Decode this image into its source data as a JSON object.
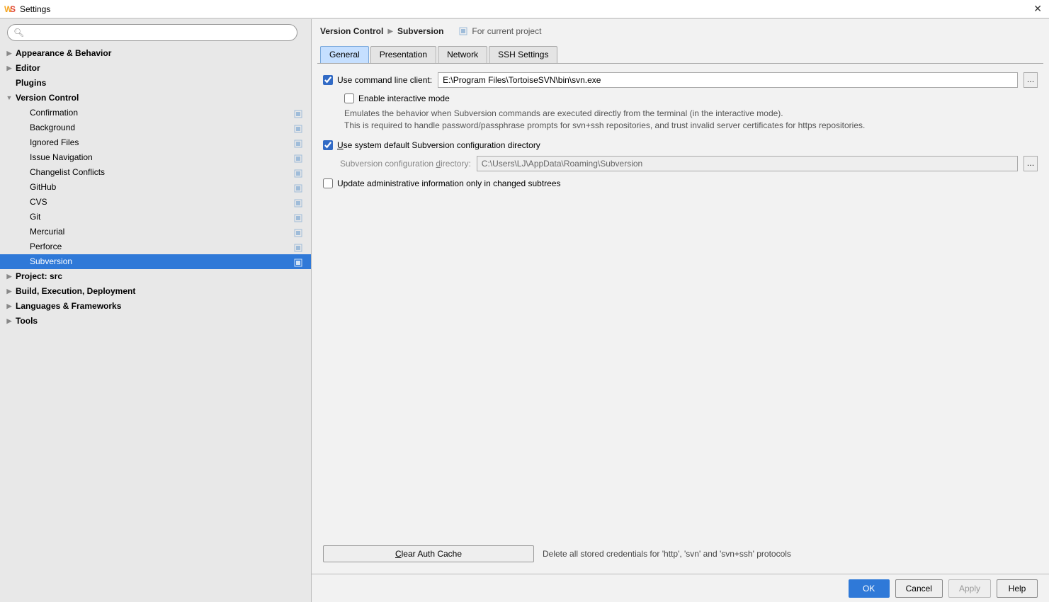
{
  "window": {
    "title": "Settings"
  },
  "search": {
    "placeholder": ""
  },
  "sidebar": {
    "items": [
      {
        "label": "Appearance & Behavior",
        "bold": true,
        "arrow": true
      },
      {
        "label": "Editor",
        "bold": true,
        "arrow": true
      },
      {
        "label": "Plugins",
        "bold": true
      },
      {
        "label": "Version Control",
        "bold": true,
        "arrow": true,
        "expanded": true,
        "children": [
          {
            "label": "Confirmation",
            "badge": true
          },
          {
            "label": "Background",
            "badge": true
          },
          {
            "label": "Ignored Files",
            "badge": true
          },
          {
            "label": "Issue Navigation",
            "badge": true
          },
          {
            "label": "Changelist Conflicts",
            "badge": true
          },
          {
            "label": "GitHub",
            "badge": true
          },
          {
            "label": "CVS",
            "badge": true
          },
          {
            "label": "Git",
            "badge": true
          },
          {
            "label": "Mercurial",
            "badge": true
          },
          {
            "label": "Perforce",
            "badge": true
          },
          {
            "label": "Subversion",
            "badge": true,
            "selected": true
          }
        ]
      },
      {
        "label": "Project: src",
        "bold": true,
        "arrow": true
      },
      {
        "label": "Build, Execution, Deployment",
        "bold": true,
        "arrow": true
      },
      {
        "label": "Languages & Frameworks",
        "bold": true,
        "arrow": true
      },
      {
        "label": "Tools",
        "bold": true,
        "arrow": true
      }
    ]
  },
  "breadcrumb": {
    "part1": "Version Control",
    "part2": "Subversion",
    "scope": "For current project"
  },
  "tabs": {
    "items": [
      {
        "label": "General",
        "active": true
      },
      {
        "label": "Presentation"
      },
      {
        "label": "Network"
      },
      {
        "label": "SSH Settings"
      }
    ]
  },
  "form": {
    "use_cli_label": "Use command line client:",
    "cli_path": "E:\\Program Files\\TortoiseSVN\\bin\\svn.exe",
    "interactive_label": "Enable interactive mode",
    "interactive_hint1": "Emulates the behavior when Subversion commands are executed directly from the terminal (in the interactive mode).",
    "interactive_hint2": "This is required to handle password/passphrase prompts for svn+ssh repositories, and trust invalid server certificates for https repositories.",
    "use_default_dir_label_pre": "U",
    "use_default_dir_label": "se system default Subversion configuration directory",
    "config_dir_label_pre": "Subversion configuration ",
    "config_dir_label_u": "d",
    "config_dir_label_post": "irectory:",
    "config_dir_value": "C:\\Users\\LJ\\AppData\\Roaming\\Subversion",
    "update_admin_label": "Update administrative information only in changed subtrees",
    "clear_cache_pre": "C",
    "clear_cache_label": "lear Auth Cache",
    "clear_cache_hint": "Delete all stored credentials for 'http', 'svn' and 'svn+ssh' protocols"
  },
  "footer": {
    "ok": "OK",
    "cancel": "Cancel",
    "apply": "Apply",
    "help": "Help"
  }
}
